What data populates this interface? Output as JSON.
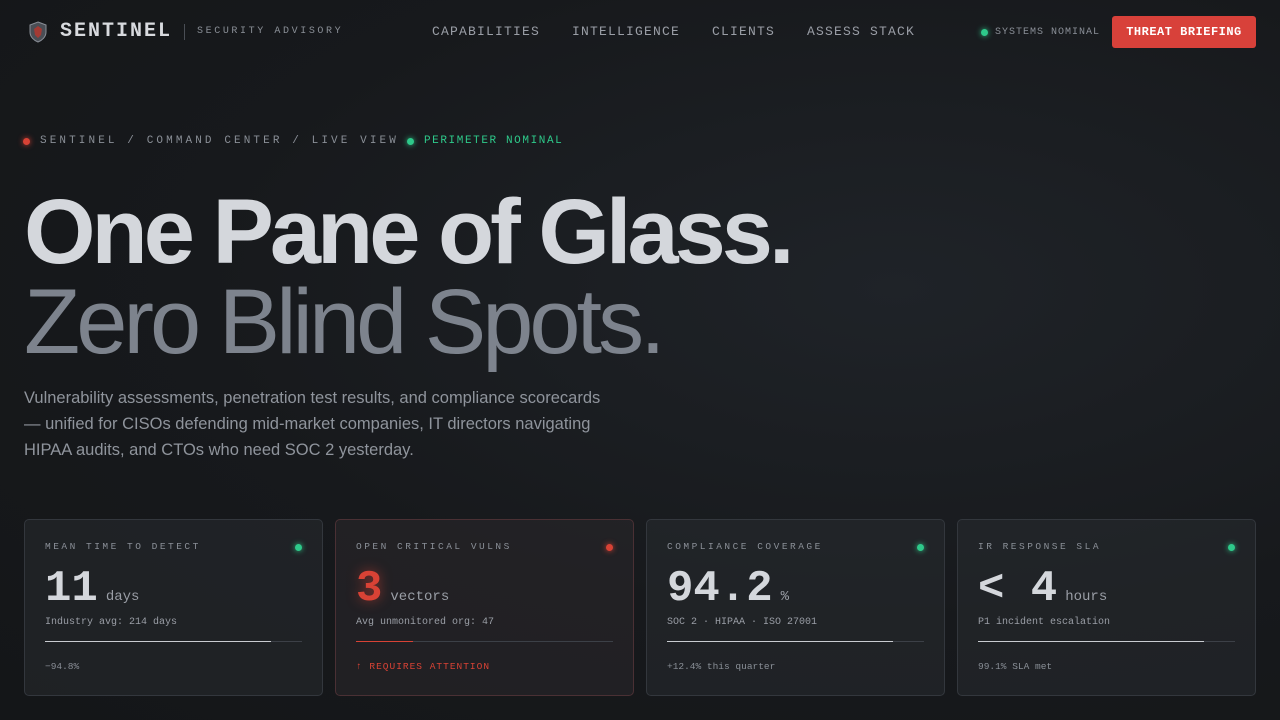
{
  "nav": {
    "brand": "SENTINEL",
    "tagline": "SECURITY ADVISORY",
    "links": [
      "CAPABILITIES",
      "INTELLIGENCE",
      "CLIENTS",
      "ASSESS STACK"
    ],
    "status": "SYSTEMS NOMINAL",
    "cta": "THREAT BRIEFING"
  },
  "breadcrumb": {
    "path": "SENTINEL / COMMAND CENTER / LIVE VIEW",
    "status": "PERIMETER NOMINAL"
  },
  "hero": {
    "title_line1": "One Pane of Glass.",
    "title_line2": "Zero Blind Spots.",
    "lede": "Vulnerability assessments, penetration test results, and compliance scorecards — unified for CISOs defending mid-market companies, IT directors navigating HIPAA audits, and CTOs who need SOC 2 yesterday."
  },
  "cards": [
    {
      "label": "MEAN TIME TO DETECT",
      "value": "11",
      "unit": "days",
      "sub": "Industry avg: 214 days",
      "progress": 0.88,
      "foot": "−94.8%",
      "status": "green"
    },
    {
      "label": "OPEN CRITICAL VULNS",
      "value": "3",
      "unit": "vectors",
      "sub": "Avg unmonitored org: 47",
      "progress": 0.22,
      "foot": "↑ REQUIRES ATTENTION",
      "status": "red"
    },
    {
      "label": "COMPLIANCE COVERAGE",
      "value": "94.2",
      "unit": "%",
      "sub": "SOC 2 · HIPAA · ISO 27001",
      "progress": 0.88,
      "foot": "+12.4% this quarter",
      "status": "green"
    },
    {
      "label": "IR RESPONSE SLA",
      "value": "< 4",
      "unit": "hours",
      "sub": "P1 incident escalation",
      "progress": 0.88,
      "foot": "99.1% SLA met",
      "status": "green"
    }
  ],
  "colors": {
    "accent": "#d8413a",
    "ok": "#2ec98a",
    "alert": "#d84235"
  }
}
